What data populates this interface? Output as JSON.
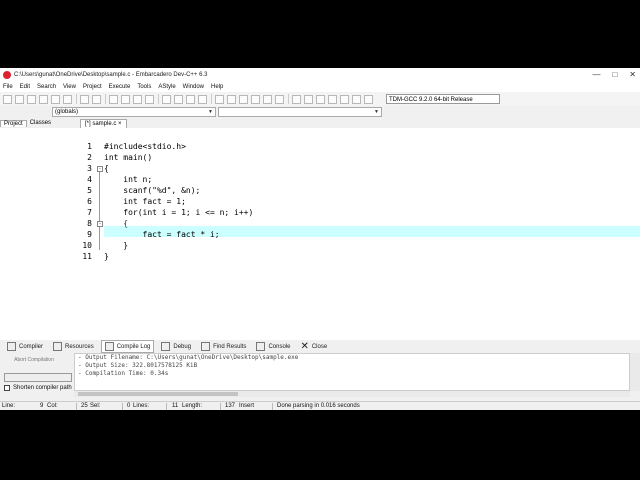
{
  "window": {
    "title": "C:\\Users\\gunat\\OneDrive\\Desktop\\sample.c - Embarcadero Dev-C++ 6.3"
  },
  "menu": [
    "File",
    "Edit",
    "Search",
    "View",
    "Project",
    "Execute",
    "Tools",
    "AStyle",
    "Window",
    "Help"
  ],
  "toolbar": {
    "compiler": "TDM-GCC 9.2.0 64-bit Release"
  },
  "combos": {
    "scope": "(globals)",
    "member": ""
  },
  "left_tabs": [
    "Project",
    "Classes"
  ],
  "editor_tab": "[*] sample.c",
  "code": [
    {
      "n": "1",
      "text": "#include<stdio.h>"
    },
    {
      "n": "2",
      "text": "int main()"
    },
    {
      "n": "3",
      "text": "{"
    },
    {
      "n": "4",
      "text": "    int n;"
    },
    {
      "n": "5",
      "text": "    scanf(\"%d\", &n);"
    },
    {
      "n": "6",
      "text": "    int fact = 1;"
    },
    {
      "n": "7",
      "text": "    for(int i = 1; i <= n; i++)"
    },
    {
      "n": "8",
      "text": "    {"
    },
    {
      "n": "9",
      "text": "        fact = fact * i;"
    },
    {
      "n": "10",
      "text": "    }"
    },
    {
      "n": "11",
      "text": "}"
    }
  ],
  "bottom_tabs": [
    "Compiler",
    "Resources",
    "Compile Log",
    "Debug",
    "Find Results",
    "Console",
    "Close"
  ],
  "sidebox": {
    "abort": "Abort Compilation",
    "shorten": "Shorten compiler path"
  },
  "log": [
    "- Output Filename: C:\\Users\\gunat\\OneDrive\\Desktop\\sample.exe",
    "- Output Size: 322.8017578125 KiB",
    "- Compilation Time: 0.34s"
  ],
  "status": {
    "line_label": "Line:",
    "line": "9",
    "col_label": "Col:",
    "col": "25",
    "sel_label": "Sel:",
    "sel": "0",
    "lines_label": "Lines:",
    "lines": "11",
    "length_label": "Length:",
    "length": "137",
    "mode": "Insert",
    "message": "Done parsing in 0.016 seconds"
  }
}
